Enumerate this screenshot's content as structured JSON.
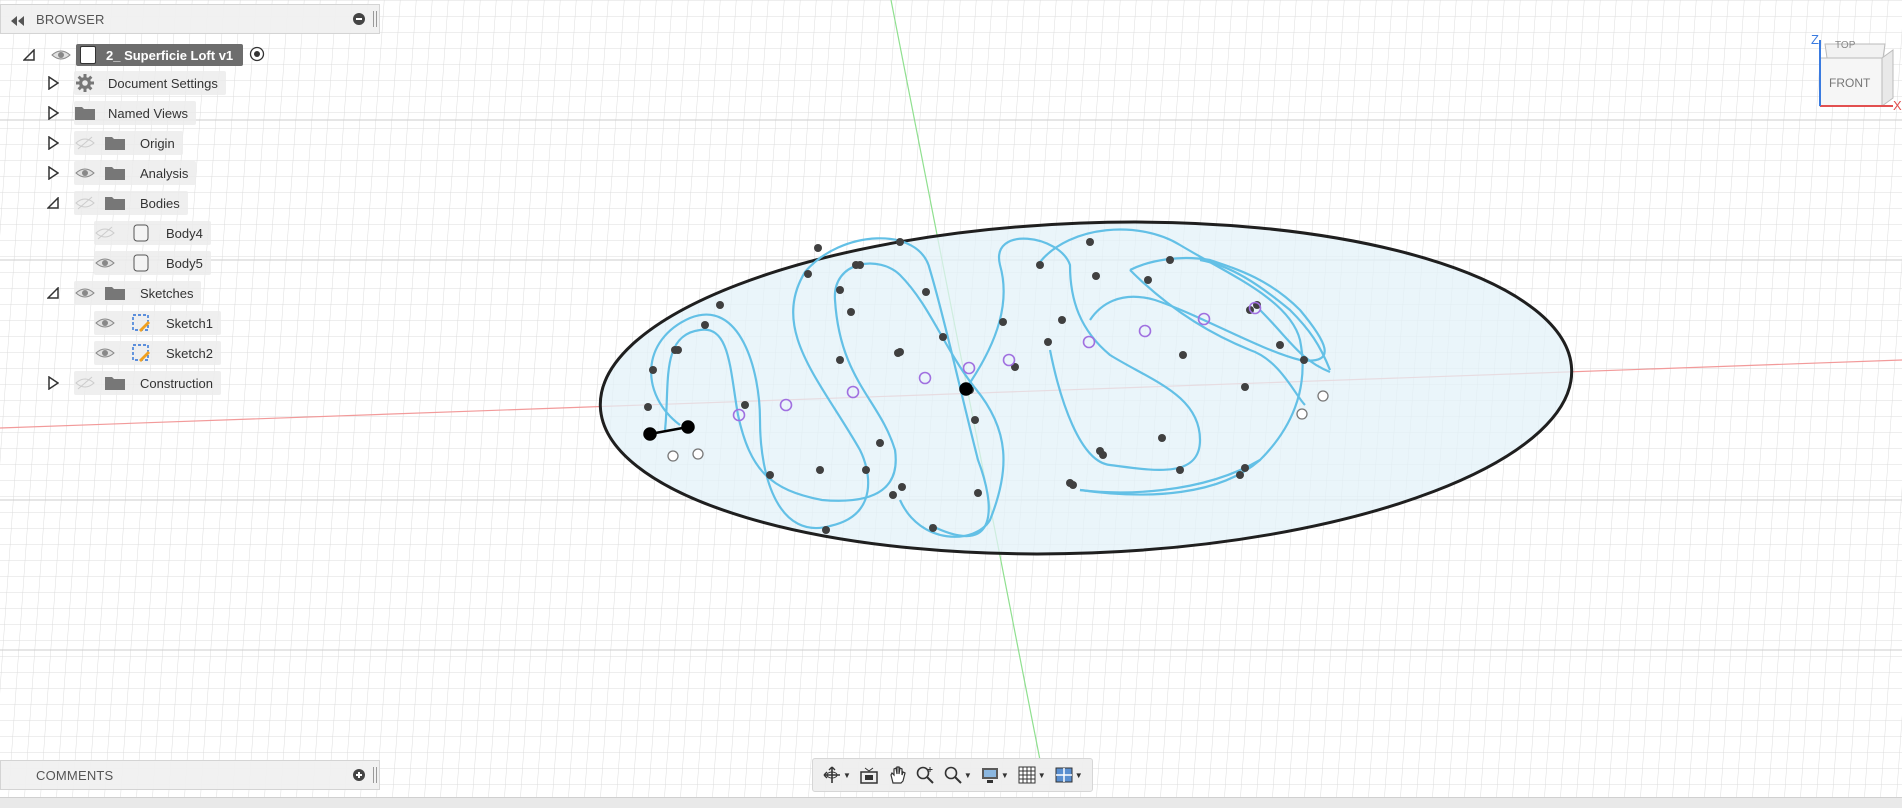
{
  "browser": {
    "title": "BROWSER",
    "root_label": "2_ Superficie Loft v1",
    "items": [
      {
        "label": "Document Settings",
        "icon": "gear-icon"
      },
      {
        "label": "Named Views",
        "icon": "folder-icon"
      },
      {
        "label": "Origin",
        "icon": "folder-icon"
      },
      {
        "label": "Analysis",
        "icon": "folder-icon"
      },
      {
        "label": "Bodies",
        "icon": "folder-icon"
      },
      {
        "label": "Body4",
        "icon": "body-icon"
      },
      {
        "label": "Body5",
        "icon": "body-icon"
      },
      {
        "label": "Sketches",
        "icon": "folder-icon"
      },
      {
        "label": "Sketch1",
        "icon": "sketch-icon"
      },
      {
        "label": "Sketch2",
        "icon": "sketch-icon"
      },
      {
        "label": "Construction",
        "icon": "folder-icon"
      }
    ]
  },
  "comments": {
    "title": "COMMENTS"
  },
  "viewcube": {
    "top": "TOP",
    "front": "FRONT",
    "z_axis": "Z",
    "x_axis": "X"
  },
  "navbar": {
    "tools": [
      "orbit-icon",
      "look-at-icon",
      "pan-icon",
      "zoom-window-icon",
      "fit-zoom-icon",
      "display-settings-icon",
      "grid-settings-icon",
      "viewports-icon"
    ]
  },
  "colors": {
    "grid": "#d9d9d9",
    "grid_major": "#c6c6c6",
    "x_axis": "#f3a3a3",
    "y_axis": "#9ee89e",
    "curve": "#6cc4e6",
    "surface": "#d6ecf6",
    "point": "#3a3a3a",
    "constraint": "#a070e0"
  }
}
